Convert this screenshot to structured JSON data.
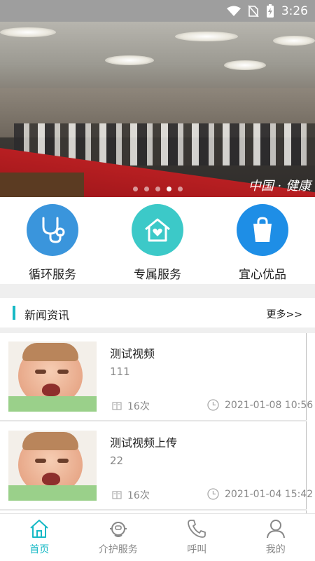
{
  "status_bar": {
    "time": "3:26",
    "icons": [
      "wifi-icon",
      "no-sim-icon",
      "battery-charging-icon"
    ]
  },
  "banner": {
    "dots": 5,
    "active_dot": 3,
    "watermark": "中国 · 健康"
  },
  "services": [
    {
      "label": "循环服务",
      "icon": "stethoscope-icon",
      "color": "#3a95dc"
    },
    {
      "label": "专属服务",
      "icon": "home-heart-icon",
      "color": "#3cc9c8"
    },
    {
      "label": "宜心优品",
      "icon": "shopping-bag-icon",
      "color": "#1e8ee6"
    }
  ],
  "news": {
    "title": "新闻资讯",
    "more": "更多>>",
    "items": [
      {
        "title": "测试视频",
        "subtitle": "111",
        "views": "16次",
        "date": "2021-01-08 10:56"
      },
      {
        "title": "测试视频上传",
        "subtitle": "22",
        "views": "16次",
        "date": "2021-01-04 15:42"
      }
    ]
  },
  "tabbar": {
    "active_color": "#17b9c5",
    "items": [
      {
        "label": "首页",
        "icon": "home-icon"
      },
      {
        "label": "介护服务",
        "icon": "nurse-icon"
      },
      {
        "label": "呼叫",
        "icon": "phone-icon"
      },
      {
        "label": "我的",
        "icon": "user-icon"
      }
    ]
  }
}
